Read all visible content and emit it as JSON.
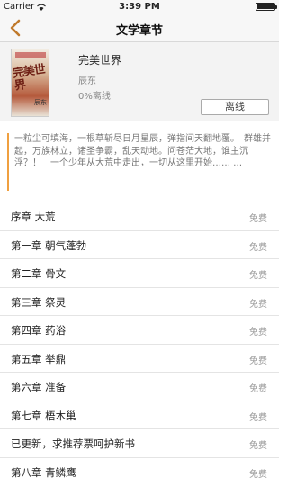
{
  "status_bar": {
    "carrier": "Carrier",
    "time": "3:39 PM",
    "battery_level": 1.0
  },
  "nav": {
    "title": "文学章节",
    "back_icon": "chevron-left-icon",
    "accent_color": "#c07a2c"
  },
  "book": {
    "cover_title": "完美世界",
    "cover_author": "—辰东",
    "title": "完美世界",
    "author": "辰东",
    "progress": "0%离线",
    "offline_button": "离线"
  },
  "description": "一粒尘可填海，一根草斩尽日月星辰，弹指间天翻地覆。　群雄并起，万族林立，诸圣争霸，乱天动地。问苍茫大地，谁主沉浮？！　一个少年从大荒中走出，一切从这里开始……  …",
  "chapters": [
    {
      "title": "序章 大荒",
      "tag": "免费"
    },
    {
      "title": "第一章 朝气蓬勃",
      "tag": "免费"
    },
    {
      "title": "第二章 骨文",
      "tag": "免费"
    },
    {
      "title": "第三章 祭灵",
      "tag": "免费"
    },
    {
      "title": "第四章 药浴",
      "tag": "免费"
    },
    {
      "title": "第五章 举鼎",
      "tag": "免费"
    },
    {
      "title": "第六章 准备",
      "tag": "免费"
    },
    {
      "title": "第七章 梧木巢",
      "tag": "免费"
    },
    {
      "title": "已更新，求推荐票呵护新书",
      "tag": "免费"
    },
    {
      "title": "第八章 青鳞鹰",
      "tag": "免费"
    }
  ]
}
